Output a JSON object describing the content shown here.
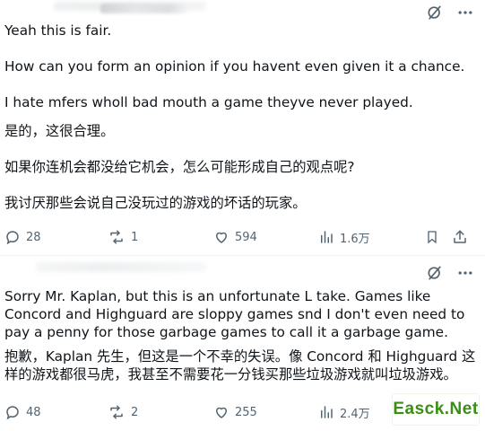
{
  "post1": {
    "text_en": "Yeah this is fair.\n\nHow can you form an opinion if you havent even given it a chance.\n\nI hate mfers wholl bad mouth a game theyve never played.",
    "text_zh": "是的，这很合理。\n\n如果你连机会都没给它机会，怎么可能形成自己的观点呢?\n\n我讨厌那些会说自己没玩过的游戏的坏话的玩家。",
    "replies": "28",
    "reposts": "1",
    "likes": "594",
    "views": "1.6万"
  },
  "post2": {
    "text_en": "Sorry Mr. Kaplan, but this is an unfortunate L take. Games like Concord and Highguard are sloppy games snd I don't even need to pay a penny for those garbage games to call it a garbage game.",
    "text_zh": "抱歉，Kaplan 先生，但这是一个不幸的失误。像 Concord 和 Highguard 这样的游戏都很马虎，我甚至不需要花一分钱买那些垃圾游戏就叫垃圾游戏。",
    "replies": "48",
    "reposts": "2",
    "likes": "255",
    "views": "2.4万"
  },
  "watermark": "Easck.Net",
  "icons": {
    "grok": "grok-icon",
    "more": "more-icon",
    "reply": "reply-icon",
    "repost": "repost-icon",
    "like": "like-icon",
    "views": "views-icon",
    "bookmark": "bookmark-icon",
    "share": "share-icon"
  },
  "colors": {
    "text": "#0f1419",
    "muted": "#536471",
    "divider": "#eff3f4",
    "watermark": "#3a8f13"
  }
}
